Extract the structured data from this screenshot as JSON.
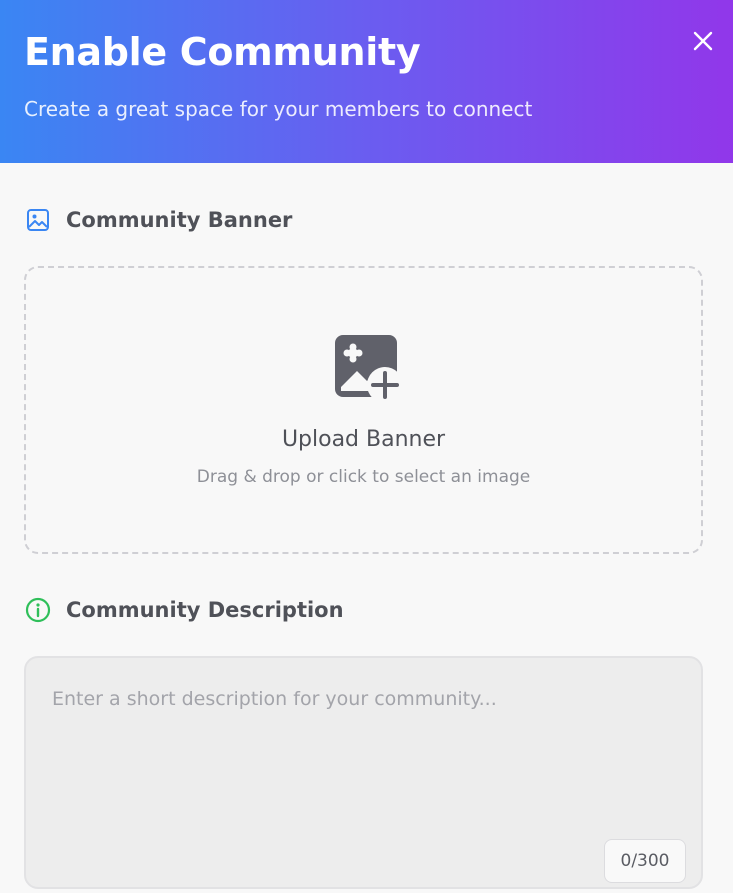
{
  "header": {
    "title": "Enable Community",
    "subtitle": "Create a great space for your members to connect",
    "close_icon": "close-icon"
  },
  "banner_section": {
    "label": "Community Banner",
    "icon": "image-icon",
    "icon_color": "#3a86f3",
    "dropzone": {
      "icon": "image-add-icon",
      "title": "Upload Banner",
      "hint": "Drag & drop or click to select an image"
    }
  },
  "description_section": {
    "label": "Community Description",
    "icon": "info-icon",
    "icon_color": "#2fbf5a",
    "placeholder": "Enter a short description for your community...",
    "value": "",
    "char_count": "0/300"
  },
  "colors": {
    "gradient_start": "#3a86f3",
    "gradient_end": "#9137ea",
    "background": "#f8f8f8"
  }
}
